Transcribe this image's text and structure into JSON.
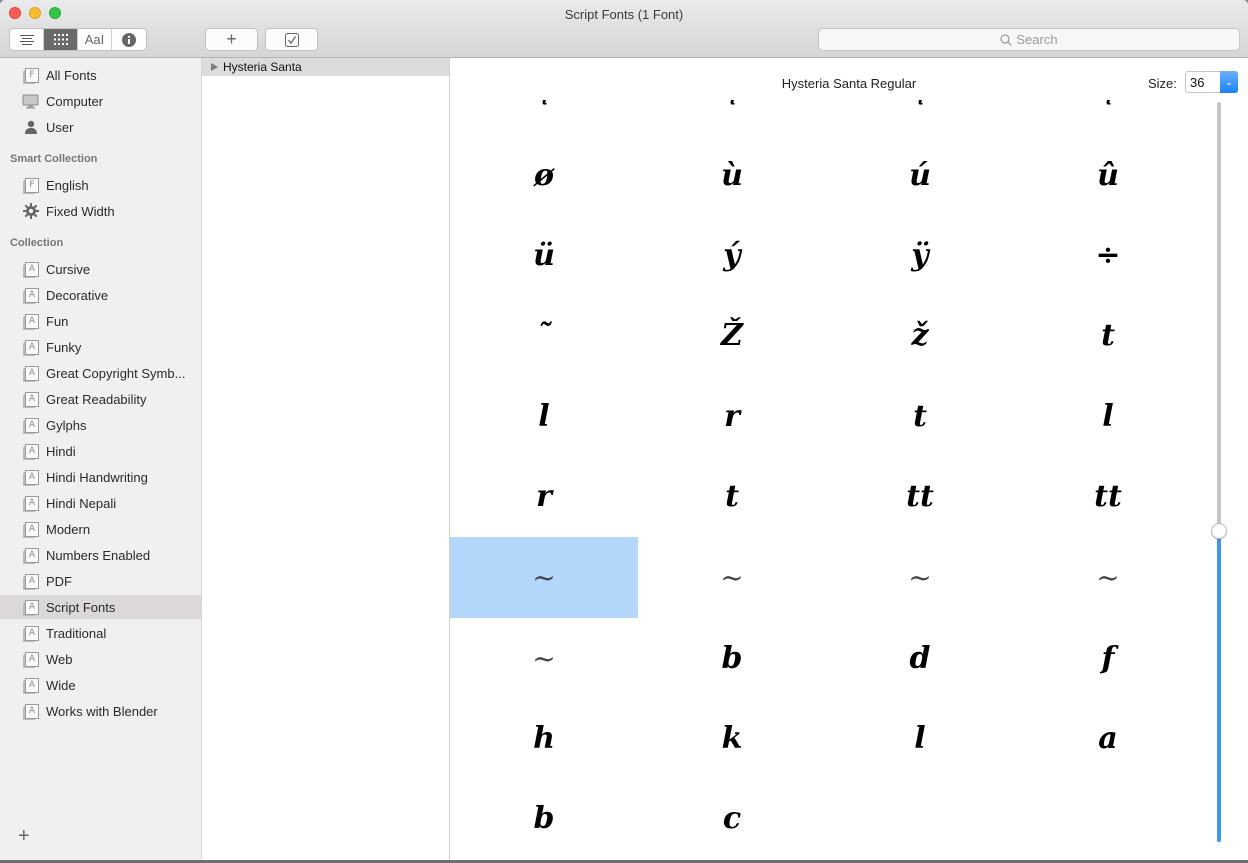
{
  "window": {
    "title": "Script Fonts (1 Font)"
  },
  "toolbar": {
    "view_modes": [
      {
        "name": "list-view",
        "icon": "≡",
        "active": false
      },
      {
        "name": "grid-view",
        "icon": "⋯",
        "active": true
      },
      {
        "name": "sample-view",
        "icon": "AaI",
        "active": false
      },
      {
        "name": "info-view",
        "icon": "i",
        "active": false
      }
    ],
    "add_label": "+",
    "validate_label": "☑",
    "search_placeholder": "Search",
    "search_icon": "magnifier-icon"
  },
  "sidebar": {
    "library_items": [
      {
        "label": "All Fonts",
        "icon": "font-book-icon"
      },
      {
        "label": "Computer",
        "icon": "computer-icon"
      },
      {
        "label": "User",
        "icon": "user-icon"
      }
    ],
    "smart_heading": "Smart Collection",
    "smart_items": [
      {
        "label": "English",
        "icon": "font-book-icon"
      },
      {
        "label": "Fixed Width",
        "icon": "gear-icon"
      }
    ],
    "collection_heading": "Collection",
    "collection_items": [
      {
        "label": "Cursive"
      },
      {
        "label": "Decorative"
      },
      {
        "label": "Fun"
      },
      {
        "label": "Funky"
      },
      {
        "label": "Great Copyright Symb..."
      },
      {
        "label": "Great Readability"
      },
      {
        "label": "Gylphs"
      },
      {
        "label": "Hindi"
      },
      {
        "label": "Hindi Handwriting"
      },
      {
        "label": "Hindi Nepali"
      },
      {
        "label": "Modern"
      },
      {
        "label": "Numbers Enabled"
      },
      {
        "label": "PDF"
      },
      {
        "label": "Script Fonts",
        "selected": true
      },
      {
        "label": "Traditional"
      },
      {
        "label": "Web"
      },
      {
        "label": "Wide"
      },
      {
        "label": "Works with Blender"
      }
    ],
    "add_label": "+"
  },
  "font_list": {
    "families": [
      {
        "name": "Hysteria Santa",
        "expanded": false
      }
    ]
  },
  "preview": {
    "font_name": "Hysteria Santa Regular",
    "size_label": "Size:",
    "size_value": "36",
    "size_slider_fraction": 0.42,
    "glyph_rows": [
      [
        "ͺ",
        "ͺ",
        "ͺ",
        "ͺ"
      ],
      [
        "ø",
        "ù",
        "ú",
        "û"
      ],
      [
        "ü",
        "ý",
        "ÿ",
        "÷"
      ],
      [
        "˜",
        "Ž",
        "ž",
        "t"
      ],
      [
        "l",
        "r",
        "t",
        "l"
      ],
      [
        "r",
        "t",
        "tt",
        "tt"
      ],
      [
        "~",
        "~",
        "~",
        "~"
      ],
      [
        "~",
        "b",
        "d",
        "f"
      ],
      [
        "h",
        "k",
        "l",
        "a"
      ],
      [
        "b",
        "c",
        "",
        ""
      ]
    ],
    "selected_cell": [
      6,
      0
    ]
  }
}
